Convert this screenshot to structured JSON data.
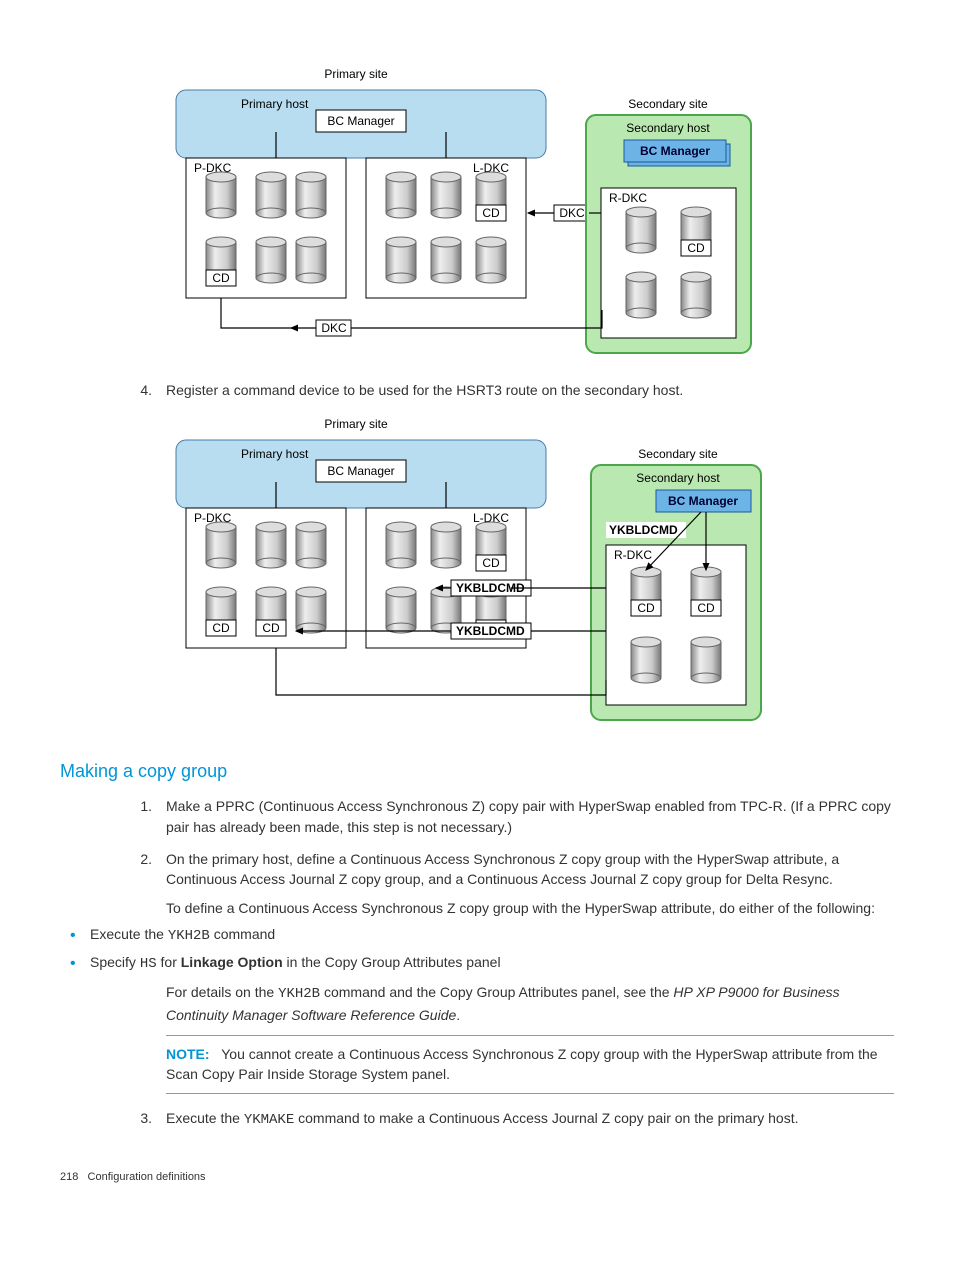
{
  "fig1": {
    "primarySite": "Primary site",
    "primaryHost": "Primary host",
    "bcManager": "BC Manager",
    "pdkc": "P-DKC",
    "ldkc": "L-DKC",
    "rdkc": "R-DKC",
    "cd": "CD",
    "dkc": "DKC",
    "secondarySite": "Secondary site",
    "secondaryHost": "Secondary host"
  },
  "step4": {
    "num": "4.",
    "text": "Register a command device to be used for the HSRT3 route on the secondary host."
  },
  "fig2": {
    "primarySite": "Primary site",
    "primaryHost": "Primary host",
    "bcManager": "BC Manager",
    "pdkc": "P-DKC",
    "ldkc": "L-DKC",
    "rdkc": "R-DKC",
    "cd": "CD",
    "ykbldcmd": "YKBLDCMD",
    "secondarySite": "Secondary site",
    "secondaryHost": "Secondary host"
  },
  "sectionHeading": "Making a copy group",
  "list1": {
    "num": "1.",
    "text": "Make a PPRC (Continuous Access Synchronous Z) copy pair with HyperSwap enabled from TPC-R. (If a PPRC copy pair has already been made, this step is not necessary.)"
  },
  "list2": {
    "num": "2.",
    "text": "On the primary host, define a Continuous Access Synchronous Z copy group with the HyperSwap attribute, a Continuous Access Journal Z copy group, and a Continuous Access Journal Z copy group for Delta Resync."
  },
  "list2para": "To define a Continuous Access Synchronous Z copy group with the HyperSwap attribute, do either of the following:",
  "bullet1a": "Execute the ",
  "bullet1code": "YKH2B",
  "bullet1b": " command",
  "bullet2a": "Specify ",
  "bullet2code": "HS",
  "bullet2b": " for ",
  "bullet2bold": "Linkage Option",
  "bullet2c": " in the Copy Group Attributes panel",
  "details1": "For details on the ",
  "detailsCode": "YKH2B",
  "details2": " command and the Copy Group Attributes panel, see the ",
  "detailsItalic": "HP XP P9000 for Business Continuity Manager Software Reference Guide",
  "details3": ".",
  "noteLabel": "NOTE:",
  "noteText": "You cannot create a Continuous Access Synchronous Z copy group with the HyperSwap attribute from the Scan Copy Pair Inside Storage System panel.",
  "list3": {
    "num": "3.",
    "text1": "Execute the ",
    "code": "YKMAKE",
    "text2": " command to make a Continuous Access Journal Z copy pair on the primary host."
  },
  "footer": {
    "page": "218",
    "title": "Configuration definitions"
  }
}
